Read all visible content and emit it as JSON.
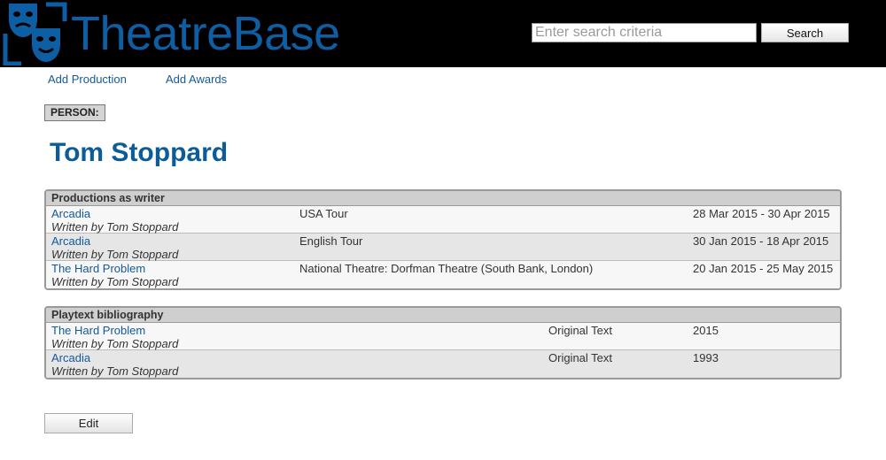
{
  "header": {
    "logo_text": "TheatreBase",
    "brand_color": "#0e5ea3",
    "search_placeholder": "Enter search criteria",
    "search_value": "",
    "search_button": "Search"
  },
  "toplinks": [
    "Add Production",
    "Add Awards"
  ],
  "person": {
    "badge": "PERSON:",
    "name": "Tom Stoppard"
  },
  "productions": {
    "title": "Productions as writer",
    "rows": [
      {
        "title": "Arcadia",
        "byline": "Written by Tom Stoppard",
        "venue": "USA Tour",
        "dates": "28 Mar 2015 - 30 Apr 2015"
      },
      {
        "title": "Arcadia",
        "byline": "Written by Tom Stoppard",
        "venue": "English Tour",
        "dates": "30 Jan 2015 - 18 Apr 2015"
      },
      {
        "title": "The Hard Problem",
        "byline": "Written by Tom Stoppard",
        "venue": "National Theatre: Dorfman Theatre (South Bank, London)",
        "dates": "20 Jan 2015 - 25 May 2015"
      }
    ]
  },
  "playtexts": {
    "title": "Playtext bibliography",
    "rows": [
      {
        "title": "The Hard Problem",
        "byline": "Written by Tom Stoppard",
        "type": "Original Text",
        "year": "2015"
      },
      {
        "title": "Arcadia",
        "byline": "Written by Tom Stoppard",
        "type": "Original Text",
        "year": "1993"
      }
    ]
  },
  "edit_button": "Edit"
}
